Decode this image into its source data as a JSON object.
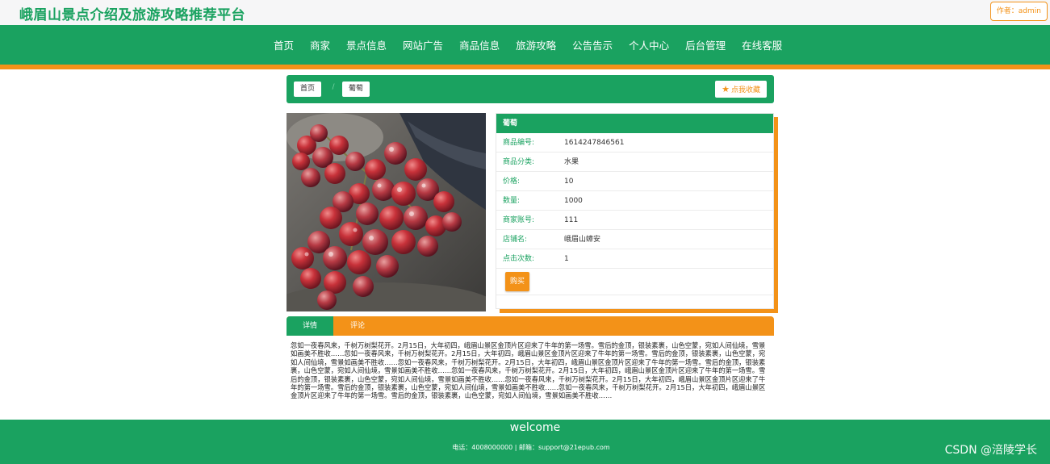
{
  "site": {
    "title": "峨眉山景点介绍及旅游攻略推荐平台",
    "author_badge": "作者：admin"
  },
  "nav": {
    "items": [
      "首页",
      "商家",
      "景点信息",
      "网站广告",
      "商品信息",
      "旅游攻略",
      "公告告示",
      "个人中心",
      "后台管理",
      "在线客服"
    ]
  },
  "breadcrumb": {
    "home": "首页",
    "separator": "/",
    "current": "葡萄"
  },
  "favorite": {
    "label": "点我收藏",
    "icon": "star-icon"
  },
  "product": {
    "image_alt": "red-grapes-photo",
    "name": "葡萄",
    "fields": [
      {
        "label": "商品编号:",
        "value": "1614247846561"
      },
      {
        "label": "商品分类:",
        "value": "水果"
      },
      {
        "label": "价格:",
        "value": "10"
      },
      {
        "label": "数量:",
        "value": "1000"
      },
      {
        "label": "商家账号:",
        "value": "111"
      },
      {
        "label": "店铺名:",
        "value": "峨眉山蟑安"
      },
      {
        "label": "点击次数:",
        "value": "1"
      }
    ],
    "buy_label": "购买"
  },
  "tabs": {
    "details": "详情",
    "comments": "评论"
  },
  "description": "忽如一夜春风来，千树万树梨花开。2月15日，大年初四，峨眉山景区金顶片区迎来了牛年的第一场雪。雪后的金顶，银装素裹，山色空蒙，宛如人间仙境，雪景如画美不胜收……忽如一夜春风来，千树万树梨花开。2月15日，大年初四，峨眉山景区金顶片区迎来了牛年的第一场雪。雪后的金顶，银装素裹，山色空蒙，宛如人间仙境，雪景如画美不胜收……忽如一夜春风来，千树万树梨花开。2月15日，大年初四，峨眉山景区金顶片区迎来了牛年的第一场雪。雪后的金顶，银装素裹，山色空蒙，宛如人间仙境，雪景如画美不胜收……忽如一夜春风来，千树万树梨花开。2月15日，大年初四，峨眉山景区金顶片区迎来了牛年的第一场雪。雪后的金顶，银装素裹，山色空蒙，宛如人间仙境，雪景如画美不胜收……忽如一夜春风来，千树万树梨花开。2月15日，大年初四，峨眉山景区金顶片区迎来了牛年的第一场雪。雪后的金顶，银装素裹，山色空蒙，宛如人间仙境，雪景如画美不胜收……忽如一夜春风来，千树万树梨花开。2月15日，大年初四，峨眉山景区金顶片区迎来了牛年的第一场雪。雪后的金顶，银装素裹，山色空蒙，宛如人间仙境，雪景如画美不胜收……",
  "footer": {
    "welcome": "welcome",
    "contact": "电话：4008000000 | 邮箱：support@21epub.com"
  },
  "watermark": "CSDN @涪陵学长",
  "colors": {
    "primary": "#1aa260",
    "accent": "#f39218"
  }
}
